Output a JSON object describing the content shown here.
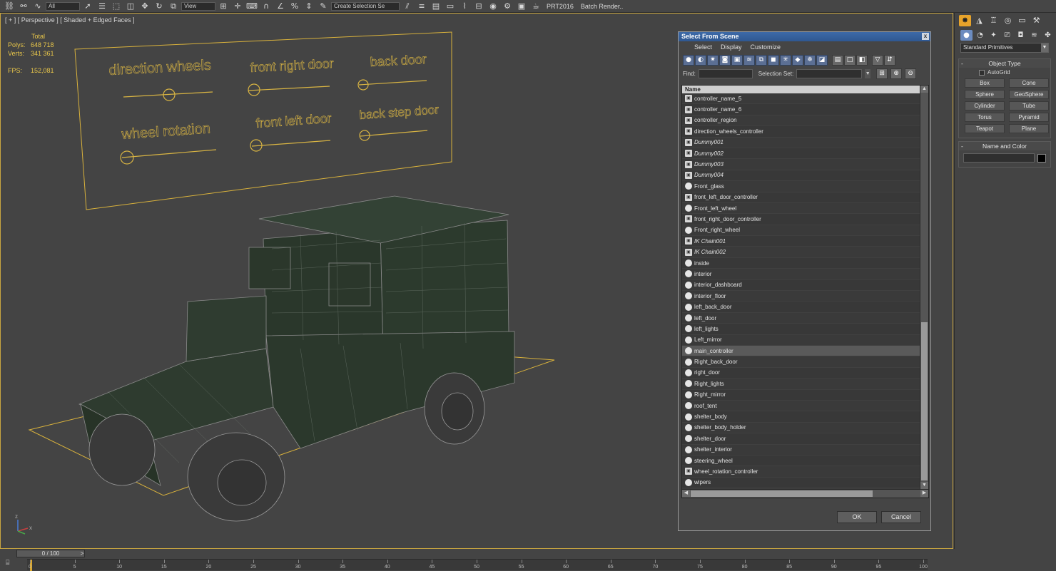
{
  "toolbar": {
    "filter_combo": "All",
    "view_combo": "View",
    "selection_set_combo": "Create Selection Se",
    "prt_label": "PRT2016",
    "batch_render_label": "Batch Render.."
  },
  "viewport": {
    "label": "[ + ] [ Perspective ] [ Shaded + Edged Faces ]",
    "stats": {
      "header": "Total",
      "polys_label": "Polys:",
      "polys_value": "648 718",
      "verts_label": "Verts:",
      "verts_value": "341 361",
      "fps_label": "FPS:",
      "fps_value": "152,081"
    },
    "controller_panel": {
      "labels": [
        "direction wheels",
        "front right door",
        "back door",
        "wheel rotation",
        "front left door",
        "back step door"
      ]
    },
    "axis_labels": {
      "x": "x",
      "z": "z"
    }
  },
  "dialog": {
    "title": "Select From Scene",
    "close": "x",
    "menu": [
      "Select",
      "Display",
      "Customize"
    ],
    "find_label": "Find:",
    "selection_set_label": "Selection Set:",
    "list_header": "Name",
    "items": [
      {
        "name": "controller_name_5",
        "type": "helper",
        "italic": false,
        "selected": false
      },
      {
        "name": "controller_name_6",
        "type": "helper",
        "italic": false,
        "selected": false
      },
      {
        "name": "controller_region",
        "type": "helper",
        "italic": false,
        "selected": false
      },
      {
        "name": "direction_wheels_controller",
        "type": "helper",
        "italic": false,
        "selected": false
      },
      {
        "name": "Dummy001",
        "type": "helper",
        "italic": true,
        "selected": false
      },
      {
        "name": "Dummy002",
        "type": "helper",
        "italic": true,
        "selected": false
      },
      {
        "name": "Dummy003",
        "type": "helper",
        "italic": true,
        "selected": false
      },
      {
        "name": "Dummy004",
        "type": "helper",
        "italic": true,
        "selected": false
      },
      {
        "name": "Front_glass",
        "type": "geometry",
        "italic": false,
        "selected": false
      },
      {
        "name": "front_left_door_controller",
        "type": "helper",
        "italic": false,
        "selected": false
      },
      {
        "name": "Front_left_wheel",
        "type": "geometry",
        "italic": false,
        "selected": false
      },
      {
        "name": "front_right_door_controller",
        "type": "helper",
        "italic": false,
        "selected": false
      },
      {
        "name": "Front_right_wheel",
        "type": "geometry",
        "italic": false,
        "selected": false
      },
      {
        "name": "IK Chain001",
        "type": "helper",
        "italic": true,
        "selected": false
      },
      {
        "name": "IK Chain002",
        "type": "helper",
        "italic": true,
        "selected": false
      },
      {
        "name": "inside",
        "type": "geometry",
        "italic": false,
        "selected": false
      },
      {
        "name": "interior",
        "type": "geometry",
        "italic": false,
        "selected": false
      },
      {
        "name": "interior_dashboard",
        "type": "geometry",
        "italic": false,
        "selected": false
      },
      {
        "name": "interior_floor",
        "type": "geometry",
        "italic": false,
        "selected": false
      },
      {
        "name": "left_back_door",
        "type": "geometry",
        "italic": false,
        "selected": false
      },
      {
        "name": "left_door",
        "type": "geometry",
        "italic": false,
        "selected": false
      },
      {
        "name": "left_lights",
        "type": "geometry",
        "italic": false,
        "selected": false
      },
      {
        "name": "Left_mirror",
        "type": "geometry",
        "italic": false,
        "selected": false
      },
      {
        "name": "main_controller",
        "type": "geometry",
        "italic": false,
        "selected": true
      },
      {
        "name": "Right_back_door",
        "type": "geometry",
        "italic": false,
        "selected": false
      },
      {
        "name": "right_door",
        "type": "geometry",
        "italic": false,
        "selected": false
      },
      {
        "name": "Right_lights",
        "type": "geometry",
        "italic": false,
        "selected": false
      },
      {
        "name": "Right_mirror",
        "type": "geometry",
        "italic": false,
        "selected": false
      },
      {
        "name": "roof_tent",
        "type": "geometry",
        "italic": false,
        "selected": false
      },
      {
        "name": "shelter_body",
        "type": "geometry",
        "italic": false,
        "selected": false
      },
      {
        "name": "shelter_body_holder",
        "type": "geometry",
        "italic": false,
        "selected": false
      },
      {
        "name": "shelter_door",
        "type": "geometry",
        "italic": false,
        "selected": false
      },
      {
        "name": "shelter_interior",
        "type": "geometry",
        "italic": false,
        "selected": false
      },
      {
        "name": "steering_wheel",
        "type": "geometry",
        "italic": false,
        "selected": false
      },
      {
        "name": "wheel_rotation_controller",
        "type": "helper",
        "italic": false,
        "selected": false
      },
      {
        "name": "wipers",
        "type": "geometry",
        "italic": false,
        "selected": false
      }
    ],
    "ok_label": "OK",
    "cancel_label": "Cancel"
  },
  "command_panel": {
    "dropdown": "Standard Primitives",
    "object_type": {
      "title": "Object Type",
      "autogrid": "AutoGrid",
      "buttons": [
        "Box",
        "Cone",
        "Sphere",
        "GeoSphere",
        "Cylinder",
        "Tube",
        "Torus",
        "Pyramid",
        "Teapot",
        "Plane"
      ]
    },
    "name_and_color": {
      "title": "Name and Color",
      "swatch_color": "#000000"
    }
  },
  "timeline": {
    "slider": "0 / 100",
    "ticks": [
      "0",
      "5",
      "10",
      "15",
      "20",
      "25",
      "30",
      "35",
      "40",
      "45",
      "50",
      "55",
      "60",
      "65",
      "70",
      "75",
      "80",
      "85",
      "90",
      "95",
      "100"
    ]
  },
  "colors": {
    "accent": "#e6a32b",
    "stats": "#e8c64a",
    "controller_text": "#d8b443",
    "selection_box": "#d9b23c",
    "title_bar": "#2f5891"
  }
}
